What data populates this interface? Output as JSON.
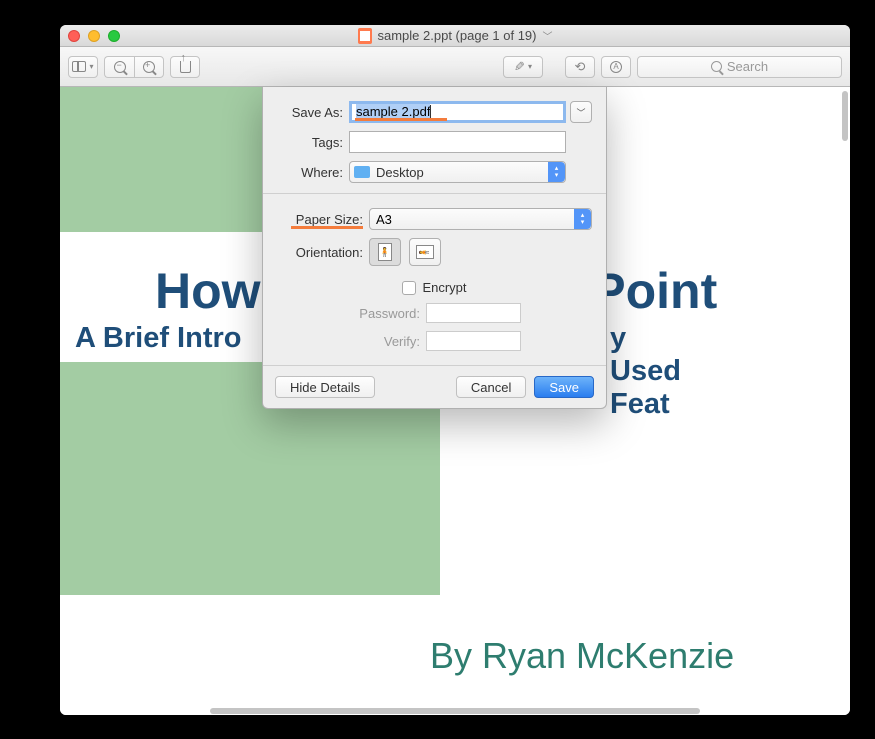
{
  "window": {
    "title": "sample 2.ppt (page 1 of 19)"
  },
  "toolbar": {
    "search_placeholder": "Search"
  },
  "slide": {
    "title_fragment_left": "How",
    "title_fragment_right": "erPoint",
    "subtitle_fragment_left": "A Brief Intro",
    "subtitle_fragment_right": "y Used Feat",
    "author": "By Ryan McKenzie"
  },
  "save_dialog": {
    "save_as_label": "Save As:",
    "save_as_value": "sample 2.pdf",
    "tags_label": "Tags:",
    "tags_value": "",
    "where_label": "Where:",
    "where_value": "Desktop",
    "paper_size_label": "Paper Size:",
    "paper_size_value": "A3",
    "orientation_label": "Orientation:",
    "encrypt_label": "Encrypt",
    "password_label": "Password:",
    "verify_label": "Verify:",
    "hide_details": "Hide Details",
    "cancel": "Cancel",
    "save": "Save"
  }
}
